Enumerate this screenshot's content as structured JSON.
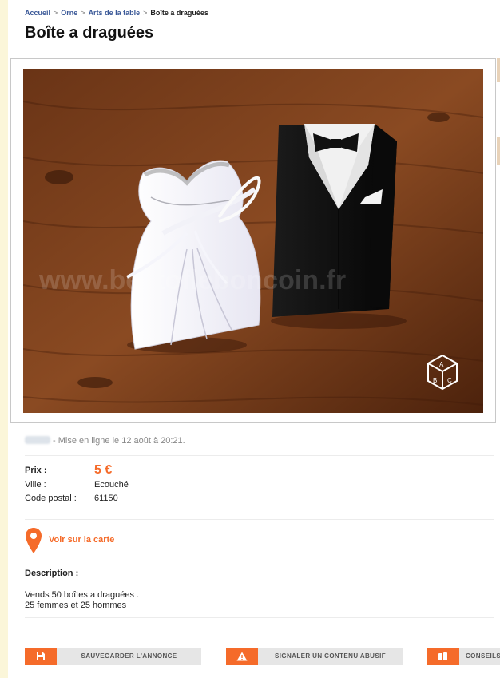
{
  "breadcrumb": {
    "items": [
      "Accueil",
      "Orne",
      "Arts de la table"
    ],
    "separator": ">",
    "current": "Boîte a draguées"
  },
  "ad": {
    "title": "Boîte a draguées",
    "watermark": "www.bestofleboncoin.fr",
    "meta": "- Mise en ligne le 12 août à 20:21.",
    "price_label": "Prix :",
    "price_value": "5 €",
    "city_label": "Ville :",
    "city_value": "Ecouché",
    "postal_label": "Code postal :",
    "postal_value": "61150",
    "map_link": "Voir sur la carte",
    "description_label": "Description :",
    "description_lines": [
      "Vends 50 boîtes a draguées .",
      "25 femmes et 25 hommes"
    ]
  },
  "actions": [
    {
      "label": "SAUVEGARDER L'ANNONCE",
      "icon": "save-icon"
    },
    {
      "label": "SIGNALER UN CONTENU ABUSIF",
      "icon": "warning-icon"
    },
    {
      "label": "CONSEILS",
      "icon": "tips-icon"
    }
  ],
  "colors": {
    "accent": "#f56b2a",
    "link": "#3b5998",
    "button_bg": "#e6e6e6"
  }
}
